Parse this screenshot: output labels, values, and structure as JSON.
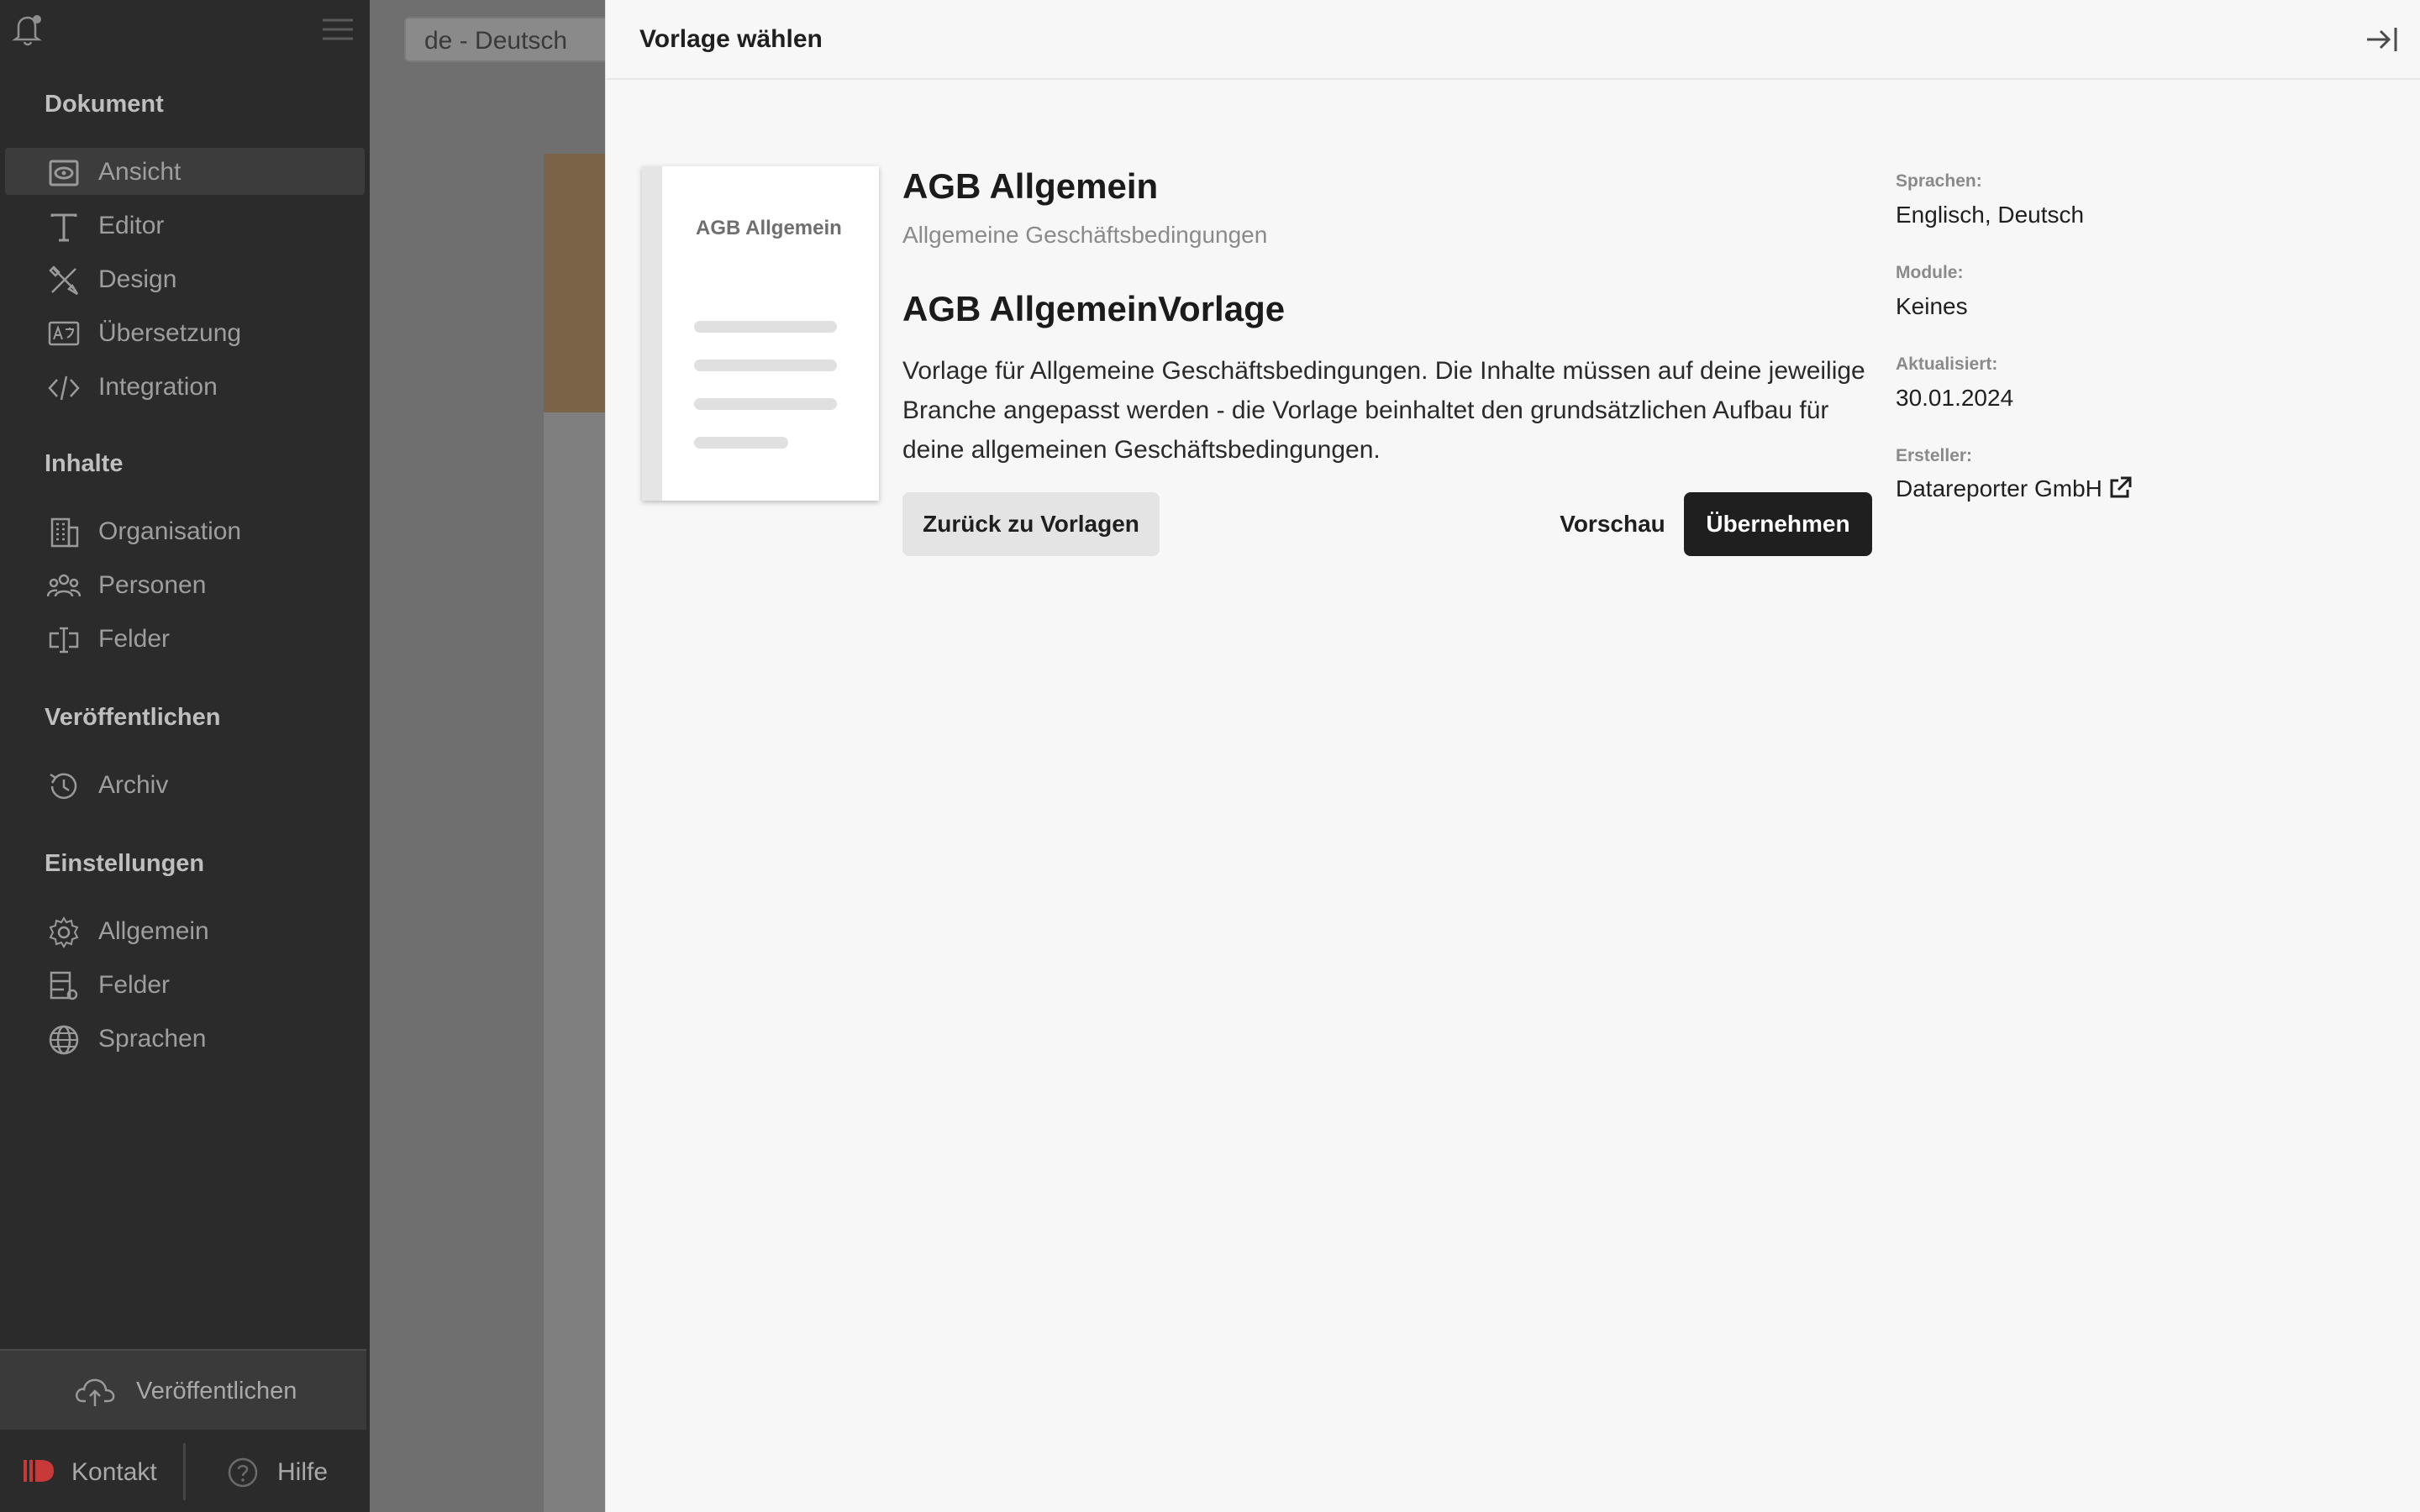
{
  "app": {
    "language_selector": "de - Deutsch"
  },
  "sidebar": {
    "sections": [
      {
        "title": "Dokument"
      },
      {
        "title": "Inhalte"
      },
      {
        "title": "Veröffentlichen"
      },
      {
        "title": "Einstellungen"
      }
    ],
    "items": [
      {
        "label": "Ansicht",
        "icon": "eye-icon",
        "active": true
      },
      {
        "label": "Editor",
        "icon": "text-icon"
      },
      {
        "label": "Design",
        "icon": "design-tools-icon"
      },
      {
        "label": "Übersetzung",
        "icon": "translate-icon"
      },
      {
        "label": "Integration",
        "icon": "code-icon"
      },
      {
        "label": "Organisation",
        "icon": "building-icon"
      },
      {
        "label": "Personen",
        "icon": "people-icon"
      },
      {
        "label": "Felder",
        "icon": "text-field-icon"
      },
      {
        "label": "Archiv",
        "icon": "history-icon"
      },
      {
        "label": "Allgemein",
        "icon": "gear-icon"
      },
      {
        "label": "Felder",
        "icon": "field-settings-icon"
      },
      {
        "label": "Sprachen",
        "icon": "globe-icon"
      }
    ],
    "publish_label": "Veröffentlichen",
    "kontakt_label": "Kontakt",
    "hilfe_label": "Hilfe"
  },
  "drawer": {
    "title": "Vorlage wählen",
    "thumbnail_title": "AGB Allgemein",
    "template": {
      "title": "AGB Allgemein",
      "subtitle": "Allgemeine Geschäftsbedingungen",
      "heading": "AGB AllgemeinVorlage",
      "description": "Vorlage für Allgemeine Geschäftsbedingungen. Die Inhalte müssen auf deine jeweilige Branche angepasst werden - die Vorlage beinhaltet den grundsätzlichen Aufbau für deine allgemeinen Geschäftsbedingungen."
    },
    "buttons": {
      "back": "Zurück zu Vorlagen",
      "preview": "Vorschau",
      "apply": "Übernehmen"
    },
    "meta": {
      "languages_label": "Sprachen:",
      "languages_value": "Englisch, Deutsch",
      "modules_label": "Module:",
      "modules_value": "Keines",
      "updated_label": "Aktualisiert:",
      "updated_value": "30.01.2024",
      "creator_label": "Ersteller:",
      "creator_value": "Datareporter GmbH"
    }
  },
  "colors": {
    "sidebar_bg": "#2b2b2b",
    "drawer_bg": "#f7f7f7",
    "primary_button": "#1f1f1f",
    "brand_red": "#c83a3a"
  }
}
